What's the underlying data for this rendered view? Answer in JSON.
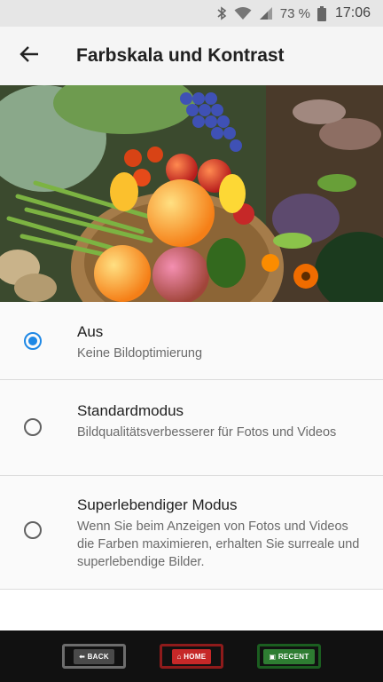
{
  "status_bar": {
    "battery_percent": "73 %",
    "time": "17:06",
    "icons": [
      "bluetooth-icon",
      "wifi-icon",
      "signal-icon",
      "battery-icon"
    ]
  },
  "app_bar": {
    "back_icon": "arrow-back-icon",
    "title": "Farbskala und Kontrast"
  },
  "hero_image": {
    "subject": "vegetable-basket-photo"
  },
  "options": [
    {
      "label": "Aus",
      "description": "Keine Bildoptimierung",
      "selected": true
    },
    {
      "label": "Standardmodus",
      "description": "Bildqualitätsverbesserer für Fotos und Videos",
      "selected": false
    },
    {
      "label": "Superlebendiger Modus",
      "description": "Wenn Sie beim Anzeigen von Fotos und Videos die Farben maximieren, erhalten Sie surreale und superlebendige Bilder.",
      "selected": false
    }
  ],
  "nav_bar": {
    "back": "⬅ BACK",
    "home": "⌂ HOME",
    "recent": "▣ RECENT"
  },
  "colors": {
    "accent": "#1e88e5",
    "status_bar_bg": "#e6e6e6",
    "app_bar_bg": "#f5f5f5",
    "nav_back": "#4a4a4a",
    "nav_home": "#c62828",
    "nav_recent": "#2e7d32"
  }
}
